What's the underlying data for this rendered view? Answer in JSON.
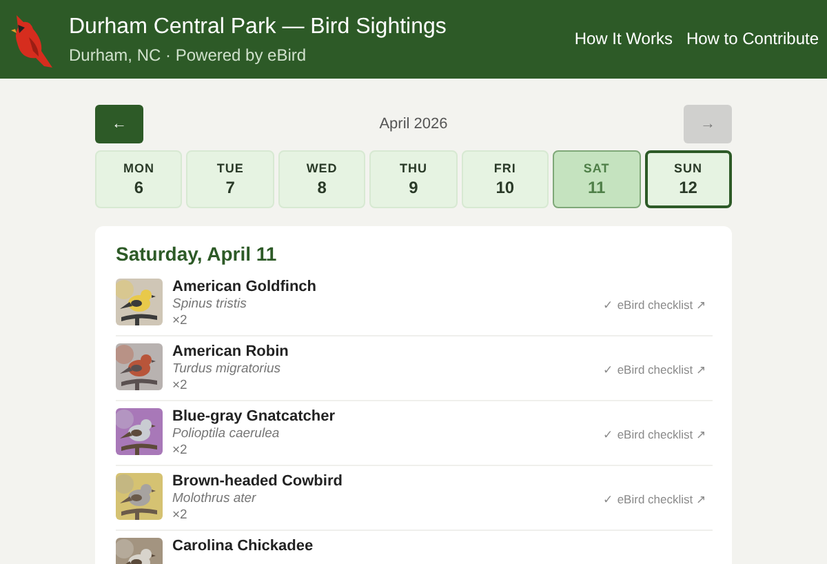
{
  "header": {
    "title": "Durham Central Park — Bird Sightings",
    "subtitle": "Durham, NC · Powered by eBird",
    "links": [
      "How It Works",
      "How to Contribute"
    ]
  },
  "calendar": {
    "month": "April 2026",
    "prev": {
      "label": "←",
      "disabled": false
    },
    "next": {
      "label": "→",
      "disabled": true
    },
    "days": [
      {
        "weekday": "MON",
        "date": "6",
        "selected": false,
        "today": false
      },
      {
        "weekday": "TUE",
        "date": "7",
        "selected": false,
        "today": false
      },
      {
        "weekday": "WED",
        "date": "8",
        "selected": false,
        "today": false
      },
      {
        "weekday": "THU",
        "date": "9",
        "selected": false,
        "today": false
      },
      {
        "weekday": "FRI",
        "date": "10",
        "selected": false,
        "today": false
      },
      {
        "weekday": "SAT",
        "date": "11",
        "selected": true,
        "today": false
      },
      {
        "weekday": "SUN",
        "date": "12",
        "selected": false,
        "today": true
      }
    ]
  },
  "sightings": {
    "heading": "Saturday, April 11",
    "items": [
      {
        "name": "American Goldfinch",
        "scientific": "Spinus tristis",
        "count": "×2",
        "link": "✓ eBird checklist ↗"
      },
      {
        "name": "American Robin",
        "scientific": "Turdus migratorius",
        "count": "×2",
        "link": "✓ eBird checklist ↗"
      },
      {
        "name": "Blue-gray Gnatcatcher",
        "scientific": "Polioptila caerulea",
        "count": "×2",
        "link": "✓ eBird checklist ↗"
      },
      {
        "name": "Brown-headed Cowbird",
        "scientific": "Molothrus ater",
        "count": "×2",
        "link": "✓ eBird checklist ↗"
      },
      {
        "name": "Carolina Chickadee"
      }
    ]
  }
}
